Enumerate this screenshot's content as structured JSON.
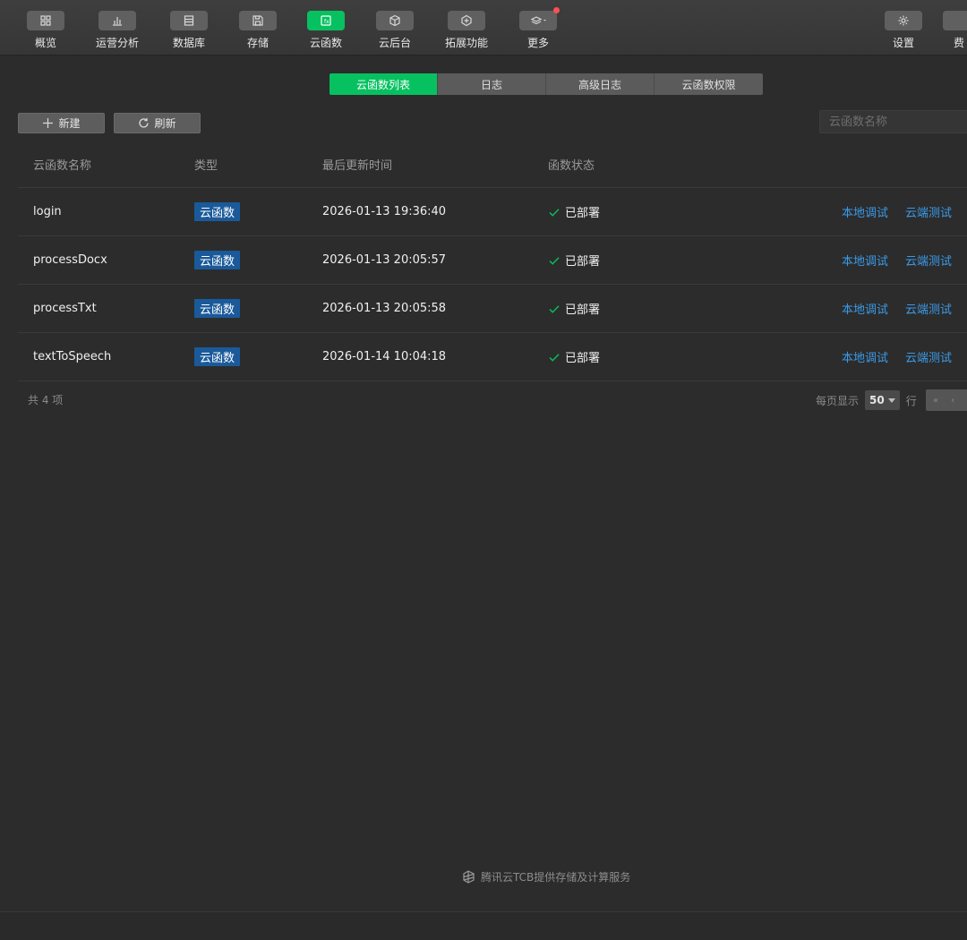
{
  "toolbar": {
    "items": [
      {
        "label": "概览",
        "icon": "grid-icon"
      },
      {
        "label": "运营分析",
        "icon": "bar-chart-icon"
      },
      {
        "label": "数据库",
        "icon": "database-icon"
      },
      {
        "label": "存储",
        "icon": "storage-icon"
      },
      {
        "label": "云函数",
        "icon": "function-icon",
        "active": true
      },
      {
        "label": "云后台",
        "icon": "cube-icon"
      },
      {
        "label": "拓展功能",
        "icon": "extension-icon"
      },
      {
        "label": "更多",
        "icon": "layers-icon"
      },
      {
        "label": "设置",
        "icon": "gear-icon"
      },
      {
        "label": "费",
        "icon": "billing-icon"
      }
    ],
    "accent": "#07c160",
    "notification_color": "#fa5151"
  },
  "tabs": [
    "云函数列表",
    "日志",
    "高级日志",
    "云函数权限"
  ],
  "actions": {
    "new_label": "新建",
    "refresh_label": "刷新"
  },
  "search": {
    "placeholder": "云函数名称"
  },
  "table": {
    "headers": {
      "name": "云函数名称",
      "type": "类型",
      "time": "最后更新时间",
      "status": "函数状态"
    },
    "rows": [
      {
        "name": "login",
        "type": "云函数",
        "time": "2026-01-13 19:36:40",
        "status": "已部署",
        "local": "本地调试",
        "cloud": "云端测试"
      },
      {
        "name": "processDocx",
        "type": "云函数",
        "time": "2026-01-13 20:05:57",
        "status": "已部署",
        "local": "本地调试",
        "cloud": "云端测试"
      },
      {
        "name": "processTxt",
        "type": "云函数",
        "time": "2026-01-13 20:05:58",
        "status": "已部署",
        "local": "本地调试",
        "cloud": "云端测试"
      },
      {
        "name": "textToSpeech",
        "type": "云函数",
        "time": "2026-01-14 10:04:18",
        "status": "已部署",
        "local": "本地调试",
        "cloud": "云端测试"
      }
    ]
  },
  "footer": {
    "total": "共 4 项",
    "per_page_prefix": "每页显示",
    "per_page_value": "50",
    "per_page_suffix": "行"
  },
  "brand": {
    "text": "腾讯云TCB提供存储及计算服务"
  }
}
